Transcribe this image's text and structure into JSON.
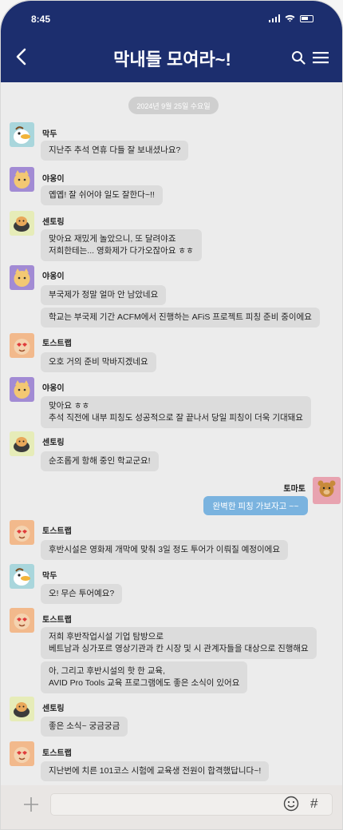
{
  "status": {
    "time": "8:45"
  },
  "header": {
    "title": "막내들 모여라~!"
  },
  "date_separator": "2024년 9월 25일 수요일",
  "messages": [
    {
      "sender": "막두",
      "avatar": "duck-avatar",
      "texts": [
        "지난주 추석 연휴 다들 잘 보내셨나요?"
      ]
    },
    {
      "sender": "야옹이",
      "avatar": "cat-avatar",
      "texts": [
        "옙옙! 잘 쉬어야 일도 잘한다~!!"
      ]
    },
    {
      "sender": "센토링",
      "avatar": "tiger-avatar",
      "texts": [
        "맞아요 재밌게 놀았으니, 또 달려야죠\n저희한테는... 영화제가 다가오잖아요 ㅎㅎ"
      ]
    },
    {
      "sender": "야옹이",
      "avatar": "cat-avatar",
      "texts": [
        "부국제가 정말 얼마 안 남았네요",
        "학교는 부국제 기간 ACFM에서 진행하는 AFiS 프로젝트 피칭 준비 중이에요"
      ]
    },
    {
      "sender": "토스트랩",
      "avatar": "peach-avatar",
      "texts": [
        "오호 거의 준비 막바지겠네요"
      ]
    },
    {
      "sender": "야옹이",
      "avatar": "cat-avatar",
      "texts": [
        "맞아요 ㅎㅎ\n추석 직전에 내부 피칭도 성공적으로 잘 끝나서 당일 피칭이 더욱 기대돼요"
      ]
    },
    {
      "sender": "센토링",
      "avatar": "tiger-avatar",
      "texts": [
        "순조롭게 항해 중인 학교군요!"
      ]
    },
    {
      "sender": "토스트랩",
      "avatar": "peach-avatar",
      "texts": [
        "후반시설은 영화제 개막에 맞춰 3일 정도 투어가 이뤄질 예정이에요"
      ]
    },
    {
      "sender": "막두",
      "avatar": "duck-avatar",
      "texts": [
        "오! 무슨 투어예요?"
      ]
    },
    {
      "sender": "토스트랩",
      "avatar": "peach-avatar",
      "texts": [
        "저희 후반작업시설 기업 탐방으로\n베트남과 싱가포르 영상기관과 칸 시장 및 시 관계자들을 대상으로 진행해요",
        "아, 그리고 후반시설의 핫 한 교육,\nAVID Pro Tools 교육 프로그램에도 좋은 소식이 있어요"
      ]
    },
    {
      "sender": "센토링",
      "avatar": "tiger-avatar",
      "texts": [
        "좋은 소식~ 궁금궁금"
      ]
    },
    {
      "sender": "토스트랩",
      "avatar": "peach-avatar",
      "texts": [
        "지난번에 치른 101코스 시험에 교육생 전원이 합격했답니다~!"
      ]
    }
  ],
  "my_message": {
    "sender": "토마토",
    "avatar": "bear-avatar",
    "text": "완벽한 피칭 가보자고 ~~"
  },
  "input": {
    "placeholder": "",
    "hash_label": "#"
  },
  "colors": {
    "header": "#1c2e6e",
    "my_bubble": "#7ab3df",
    "bubble": "#dcdcdc"
  }
}
